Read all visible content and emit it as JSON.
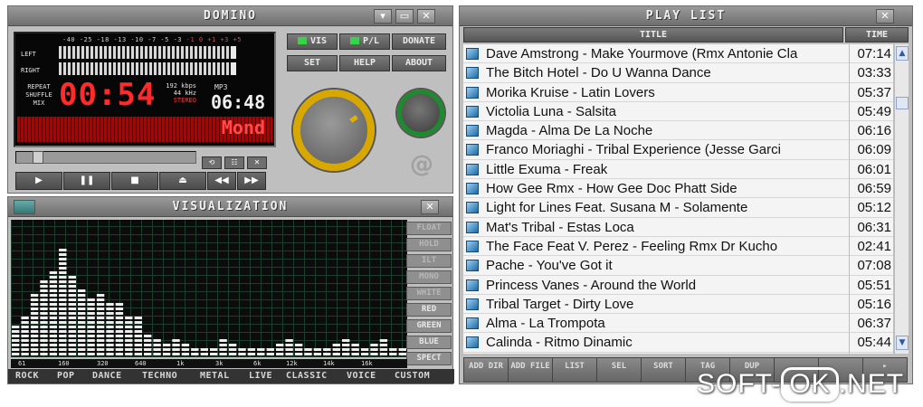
{
  "player": {
    "title": "DOMINO",
    "window_btns": [
      "▾",
      "▭",
      "✕"
    ],
    "db_scale_white": "-40 -25 -18 -13 -10 -7 -5 -3",
    "db_scale_red": "-1 0 +1 +3 +5",
    "vu_left": "LEFT",
    "vu_right": "RIGHT",
    "modes": [
      "REPEAT",
      "SHUFFLE",
      "MIX"
    ],
    "time": "00:54",
    "bitrate": "192 kbps",
    "samplerate": "44 kHz",
    "stereo": "STEREO",
    "format": "MP3",
    "clock": "06:48",
    "scroller_text": "Mond",
    "mini_buttons": [
      "⟲",
      "☷",
      "✕"
    ],
    "transport": [
      "▶",
      "❚❚",
      "■",
      "⏏",
      "◀◀",
      "▶▶"
    ],
    "vis_btn": "VIS",
    "pl_btn": "P/L",
    "donate_btn": "DONATE",
    "set_btn": "SET",
    "help_btn": "HELP",
    "about_btn": "ABOUT",
    "logo": "@"
  },
  "viz": {
    "title": "VISUALIZATION",
    "close": "✕",
    "side_buttons": [
      "FLOAT",
      "HOLD",
      "ILT",
      "MONO",
      "WHITE",
      "RED",
      "GREEN",
      "BLUE",
      "SPECT"
    ],
    "freqs": [
      "61",
      "160",
      "320",
      "640",
      "1k",
      "3k",
      "6k",
      "12k",
      "14k",
      "16k"
    ],
    "presets": [
      "ROCK",
      "POP",
      "DANCE",
      "TECHNO",
      "METAL",
      "LIVE",
      "CLASSIC",
      "VOICE",
      "CUSTOM"
    ],
    "spectrum_levels": [
      0.22,
      0.3,
      0.45,
      0.55,
      0.62,
      0.8,
      0.6,
      0.48,
      0.42,
      0.46,
      0.4,
      0.38,
      0.3,
      0.28,
      0.18,
      0.12,
      0.1,
      0.12,
      0.1,
      0.08,
      0.08,
      0.07,
      0.12,
      0.1,
      0.08,
      0.06,
      0.06,
      0.08,
      0.1,
      0.12,
      0.1,
      0.08,
      0.07,
      0.08,
      0.1,
      0.12,
      0.1,
      0.08,
      0.1,
      0.12,
      0.08,
      0.06
    ]
  },
  "playlist": {
    "title": "PLAY LIST",
    "close": "✕",
    "col_title": "TITLE",
    "col_time": "TIME",
    "rows": [
      {
        "title": "Dave Amstrong - Make Yourmove (Rmx Antonie Cla",
        "time": "07:14"
      },
      {
        "title": "The Bitch Hotel - Do U Wanna Dance",
        "time": "03:33"
      },
      {
        "title": "Morika Kruise - Latin Lovers",
        "time": "05:37"
      },
      {
        "title": "Victolia Luna - Salsita",
        "time": "05:49"
      },
      {
        "title": "Magda - Alma De La Noche",
        "time": "06:16"
      },
      {
        "title": "Franco Moriaghi - Tribal Experience (Jesse Garci",
        "time": "06:09"
      },
      {
        "title": "Little Exuma - Freak",
        "time": "06:01"
      },
      {
        "title": "How Gee Rmx - How Gee Doc Phatt Side",
        "time": "06:59"
      },
      {
        "title": "Light for Lines Feat. Susana M - Solamente",
        "time": "05:12"
      },
      {
        "title": "Mat's Tribal - Estas Loca",
        "time": "06:31"
      },
      {
        "title": "The Face Feat V. Perez - Feeling Rmx Dr Kucho",
        "time": "02:41"
      },
      {
        "title": "Pache - You've Got it",
        "time": "07:08"
      },
      {
        "title": "Princess Vanes - Around the World",
        "time": "05:51"
      },
      {
        "title": "Tribal Target - Dirty Love",
        "time": "05:16"
      },
      {
        "title": "Alma - La Trompota",
        "time": "06:37"
      },
      {
        "title": "Calinda - Ritmo Dinamic",
        "time": "05:44"
      }
    ],
    "buttons": [
      "ADD DIR",
      "ADD FILE",
      "LIST",
      "SEL",
      "SORT",
      "TAG",
      "DUP",
      "",
      "",
      "▸"
    ]
  },
  "watermark": {
    "left": "SOFT-",
    "box": "OK",
    "right": ".NET"
  },
  "colors": {
    "vol_ring": "#d8a800",
    "bal_ring": "#1e8a2e",
    "led_red": "#ff2a2a"
  }
}
